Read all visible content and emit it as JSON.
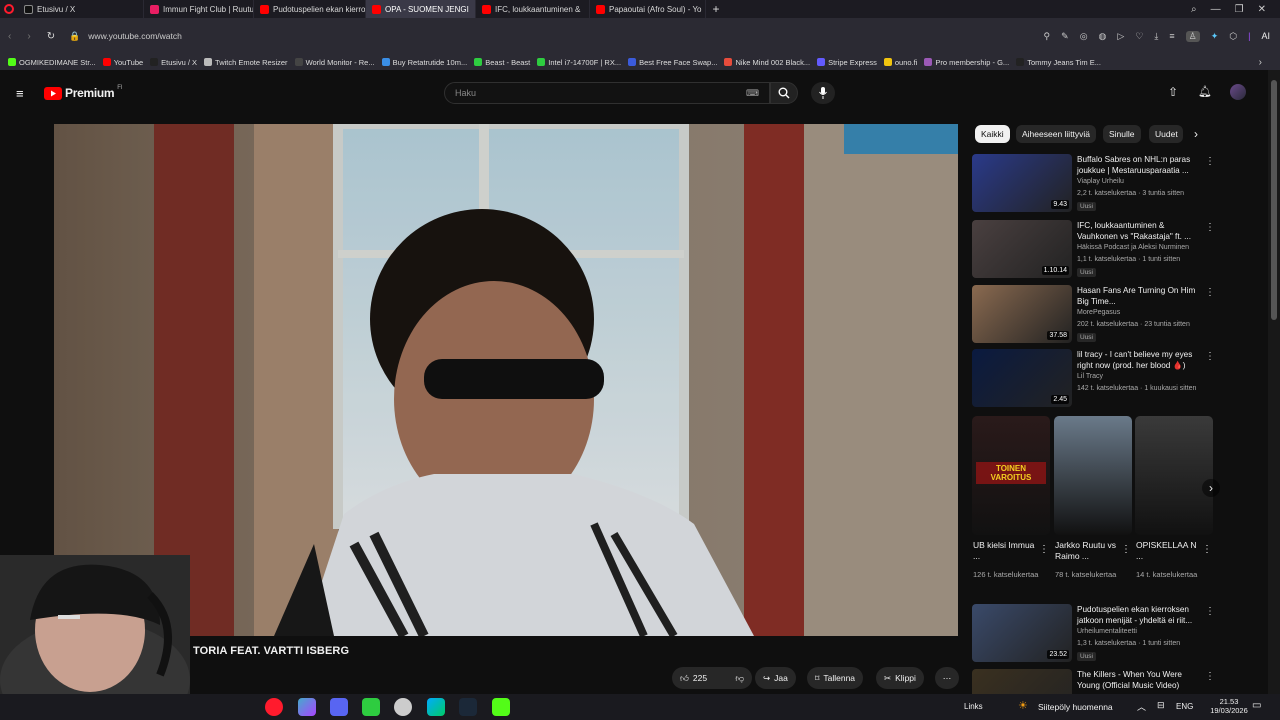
{
  "browser": {
    "tabs": [
      {
        "label": "Etusivu / X",
        "color": "#111"
      },
      {
        "label": "Immun Fight Club | Ruutu",
        "color": "#e91e63"
      },
      {
        "label": "Pudotuspelien ekan kierro",
        "color": "#ff0000"
      },
      {
        "label": "OPA - SUOMEN JENGI",
        "color": "#ff0000"
      },
      {
        "label": "IFC, loukkaantuminen &",
        "color": "#ff0000"
      },
      {
        "label": "Papaoutai (Afro Soul) - Yo",
        "color": "#ff0000"
      }
    ],
    "url": "www.youtube.com/watch",
    "ai_label": "AI",
    "bookmarks": [
      {
        "label": "OGMIKEDIMANE Str...",
        "color": "#53fc18"
      },
      {
        "label": "YouTube",
        "color": "#ff0000"
      },
      {
        "label": "Etusivu / X",
        "color": "#222"
      },
      {
        "label": "Twitch Emote Resizer",
        "color": "#bbb"
      },
      {
        "label": "World Monitor - Re...",
        "color": "#444"
      },
      {
        "label": "Buy Retatrutide 10m...",
        "color": "#3a8ee6"
      },
      {
        "label": "Beast - Beast",
        "color": "#2ecc40"
      },
      {
        "label": "Intel i7-14700F | RX...",
        "color": "#2ecc40"
      },
      {
        "label": "Best Free Face Swap...",
        "color": "#3b5bdb"
      },
      {
        "label": "Nike Mind 002 Black...",
        "color": "#e74c3c"
      },
      {
        "label": "Stripe Express",
        "color": "#635bff"
      },
      {
        "label": "ouno.fi",
        "color": "#f1c40f"
      },
      {
        "label": "Pro membership - G...",
        "color": "#9b59b6"
      },
      {
        "label": "Tommy Jeans Tim E...",
        "color": "#222"
      }
    ]
  },
  "youtube": {
    "logo": "Premium",
    "logo_sup": "FI",
    "search_placeholder": "Haku",
    "chips": [
      "Kaikki",
      "Aiheeseen liittyviä",
      "Sinulle",
      "Uudet"
    ],
    "video_caption": "TORIA FEAT. VARTTI ISBERG",
    "actions": {
      "likes": "225",
      "share": "Jaa",
      "save": "Tallenna",
      "clip": "Klippi"
    },
    "recs": [
      {
        "title": "Buffalo Sabres on NHL:n paras joukkue | Mestaruusparaatia ...",
        "channel": "Viaplay Urheilu",
        "meta": "2,2 t. katselukertaa · 3 tuntia sitten",
        "badge": "Uusi",
        "duration": "9.43",
        "thumb": "#2a3a8a"
      },
      {
        "title": "IFC, loukkaantuminen & Vauhkonen vs \"Rakastaja\" ft. ...",
        "channel": "Häkissä Podcast ja Aleksi Nurminen",
        "meta": "1,1 t. katselukertaa · 1 tunti sitten",
        "badge": "Uusi",
        "duration": "1.10.14",
        "thumb": "#4a4040"
      },
      {
        "title": "Hasan Fans Are Turning On Him Big Time...",
        "channel": "MorePegasus",
        "meta": "202 t. katselukertaa · 23 tuntia sitten",
        "badge": "Uusi",
        "duration": "37.58",
        "thumb": "#8a6a50"
      },
      {
        "title": "lil tracy - I can't believe my eyes right now (prod. her blood 🩸)",
        "channel": "Lil Tracy",
        "meta": "142 t. katselukertaa · 1 kuukausi sitten",
        "badge": "",
        "duration": "2.45",
        "thumb": "#0a1a40"
      },
      {
        "title": "Pudotuspelien ekan kierroksen jatkoon menijät - yhdeltä ei riit...",
        "channel": "Urheilumentaliteetti",
        "meta": "1,3 t. katselukertaa · 1 tunti sitten",
        "badge": "Uusi",
        "duration": "23.52",
        "thumb": "#3a4a6a"
      },
      {
        "title": "The Killers - When You Were Young (Official Music Video)",
        "channel": "",
        "meta": "",
        "badge": "",
        "duration": "",
        "thumb": "#3a3020"
      }
    ],
    "shorts": [
      {
        "title": "UB kielsi Immua ...",
        "views": "126 t. katselukertaa",
        "overlay": "TOINEN VAROITUS",
        "color": "#2a1a1a"
      },
      {
        "title": "Jarkko Ruutu vs Raimo ...",
        "views": "78 t. katselukertaa",
        "overlay": "",
        "color": "#6a7a8a"
      },
      {
        "title": "OPISKELLAA N ...",
        "views": "14 t. katselukertaa",
        "overlay": "",
        "color": "#3a3a3a"
      }
    ]
  },
  "taskbar": {
    "links": "Links",
    "weather": "Siitepöly huomenna",
    "lang": "ENG",
    "time": "21.53",
    "date": "19/03/2026"
  }
}
